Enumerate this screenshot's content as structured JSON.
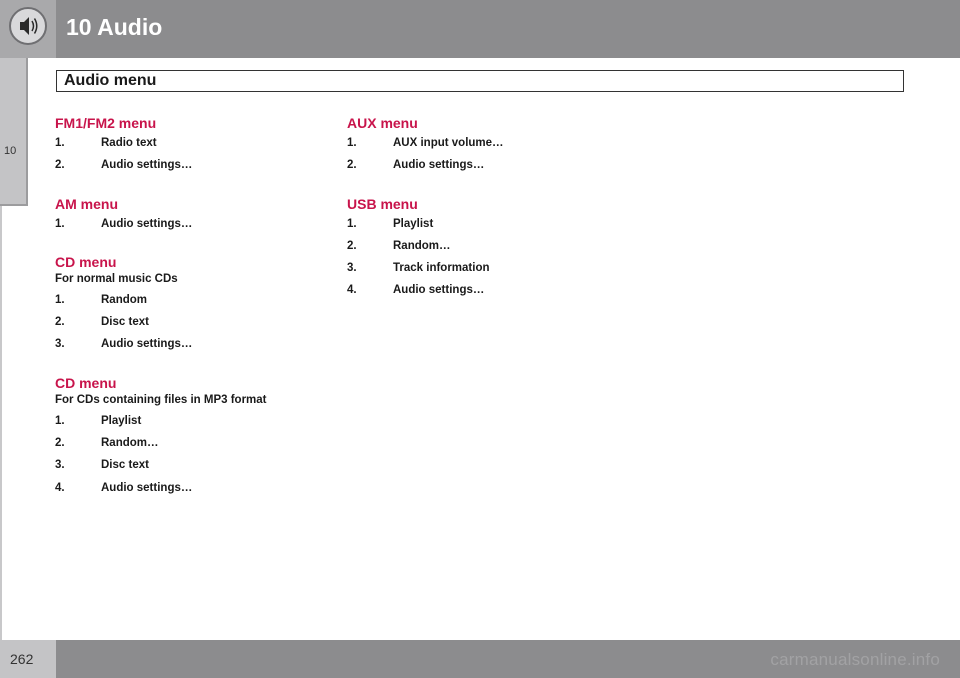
{
  "header": {
    "chapter_title": "10 Audio",
    "section_title": "Audio menu"
  },
  "side_tab": {
    "label": "10"
  },
  "left_column": [
    {
      "heading": "FM1/FM2 menu",
      "items": [
        {
          "num": "1.",
          "text": "Radio text"
        },
        {
          "num": "2.",
          "text": "Audio settings…"
        }
      ]
    },
    {
      "heading": "AM menu",
      "items": [
        {
          "num": "1.",
          "text": "Audio settings…"
        }
      ]
    },
    {
      "heading": "CD menu",
      "subtitle": "For normal music CDs",
      "items": [
        {
          "num": "1.",
          "text": "Random"
        },
        {
          "num": "2.",
          "text": "Disc text"
        },
        {
          "num": "3.",
          "text": "Audio settings…"
        }
      ]
    },
    {
      "heading": "CD menu",
      "subtitle": "For CDs containing files in MP3 format",
      "items": [
        {
          "num": "1.",
          "text": "Playlist"
        },
        {
          "num": "2.",
          "text": "Random…"
        },
        {
          "num": "3.",
          "text": "Disc text"
        },
        {
          "num": "4.",
          "text": "Audio settings…"
        }
      ]
    }
  ],
  "right_column": [
    {
      "heading": "AUX menu",
      "items": [
        {
          "num": "1.",
          "text": "AUX input volume…"
        },
        {
          "num": "2.",
          "text": "Audio settings…"
        }
      ]
    },
    {
      "heading": "USB menu",
      "items": [
        {
          "num": "1.",
          "text": "Playlist"
        },
        {
          "num": "2.",
          "text": "Random…"
        },
        {
          "num": "3.",
          "text": "Track information"
        },
        {
          "num": "4.",
          "text": "Audio settings…"
        }
      ]
    }
  ],
  "footer": {
    "page_number": "262",
    "watermark": "carmanualsonline.info"
  },
  "colors": {
    "heading": "#c8144b",
    "header_bar": "#8c8c8e",
    "tab": "#c4c4c6"
  },
  "icons": {
    "chapter": "speaker-icon"
  }
}
